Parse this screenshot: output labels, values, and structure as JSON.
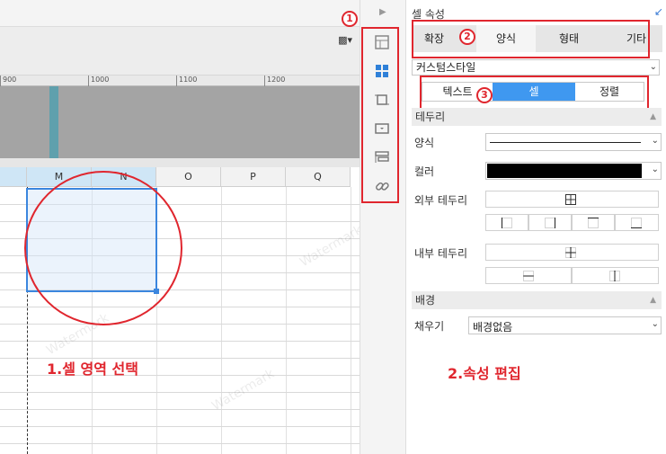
{
  "designer": {
    "ruler_ticks": [
      "900",
      "1000",
      "1100",
      "1200"
    ],
    "columns": [
      "M",
      "N",
      "O",
      "P",
      "Q"
    ],
    "selected_columns": [
      "M",
      "N"
    ],
    "watermark": "Watermark"
  },
  "annotations": {
    "badge1": "1",
    "badge2": "2",
    "badge3": "3",
    "note_select": "1.셀 영역 선택",
    "note_edit": "2.속성 편집"
  },
  "toolbar": {
    "tools": [
      {
        "icon": "table-grid-icon",
        "active": false
      },
      {
        "icon": "cell-properties-icon",
        "active": true
      },
      {
        "icon": "crop-frame-icon",
        "active": false
      },
      {
        "icon": "dropdown-box-icon",
        "active": false
      },
      {
        "icon": "layers-icon",
        "active": false
      },
      {
        "icon": "link-icon",
        "active": false
      }
    ]
  },
  "panel": {
    "title": "셀 속성",
    "tabs": [
      "확장",
      "양식",
      "형태",
      "기타"
    ],
    "active_tab": "양식",
    "style_select": "커스텀스타일",
    "sub_tabs": [
      "텍스트",
      "셀",
      "정렬"
    ],
    "active_sub_tab": "셀",
    "border_section": "테두리",
    "line_style_label": "양식",
    "color_label": "컬러",
    "color_value": "#000000",
    "outer_border_label": "외부 테두리",
    "inner_border_label": "내부 테두리",
    "background_section": "배경",
    "fill_label": "채우기",
    "fill_value": "배경없음"
  },
  "colors": {
    "accent": "#3f98f0",
    "annotation_red": "#e0262e",
    "selection": "#3b86de"
  }
}
